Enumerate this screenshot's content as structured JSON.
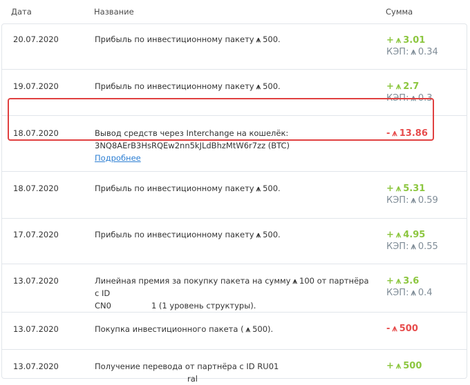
{
  "header": {
    "date": "Дата",
    "name": "Название",
    "amount": "Сумма"
  },
  "currency_symbol": "⩚",
  "rows": [
    {
      "date": "20.07.2020",
      "name_prefix": "Прибыль по инвестиционному пакету",
      "name_value": "500.",
      "amount_sign": "+",
      "amount_value": "3.01",
      "cap_label": "КЭП:",
      "cap_value": "0.34"
    },
    {
      "date": "19.07.2020",
      "name_prefix": "Прибыль по инвестиционному пакету",
      "name_value": "500.",
      "amount_sign": "+",
      "amount_value": "2.7",
      "cap_label": "КЭП:",
      "cap_value": "0.3"
    },
    {
      "date": "18.07.2020",
      "name_line1": "Вывод средств через Interchange на кошелёк:",
      "name_line2": "3NQ8AErB3HsRQEw2nn5kJLdBhzMtW6r7zz (BTC)",
      "link": "Подробнее",
      "amount_sign": "-",
      "amount_value": "13.86"
    },
    {
      "date": "18.07.2020",
      "name_prefix": "Прибыль по инвестиционному пакету",
      "name_value": "500.",
      "amount_sign": "+",
      "amount_value": "5.31",
      "cap_label": "КЭП:",
      "cap_value": "0.59"
    },
    {
      "date": "17.07.2020",
      "name_prefix": "Прибыль по инвестиционному пакету",
      "name_value": "500.",
      "amount_sign": "+",
      "amount_value": "4.95",
      "cap_label": "КЭП:",
      "cap_value": "0.55"
    },
    {
      "date": "13.07.2020",
      "name_line1_prefix": "Линейная премия за покупку пакета на сумму",
      "name_line1_value": "100 от партнёра с ID",
      "name_line2_prefix": "CN0",
      "name_line2_suffix": "1 (1 уровень структуры).",
      "amount_sign": "+",
      "amount_value": "3.6",
      "cap_label": "КЭП:",
      "cap_value": "0.4"
    },
    {
      "date": "13.07.2020",
      "name_prefix": "Покупка инвестиционного пакета (",
      "name_value": "500).",
      "amount_sign": "-",
      "amount_value": "500"
    },
    {
      "date": "13.07.2020",
      "name_prefix": "Получение перевода от партнёра с ID RU01",
      "name_suffix": "ral",
      "amount_sign": "+",
      "amount_value": "500"
    }
  ]
}
